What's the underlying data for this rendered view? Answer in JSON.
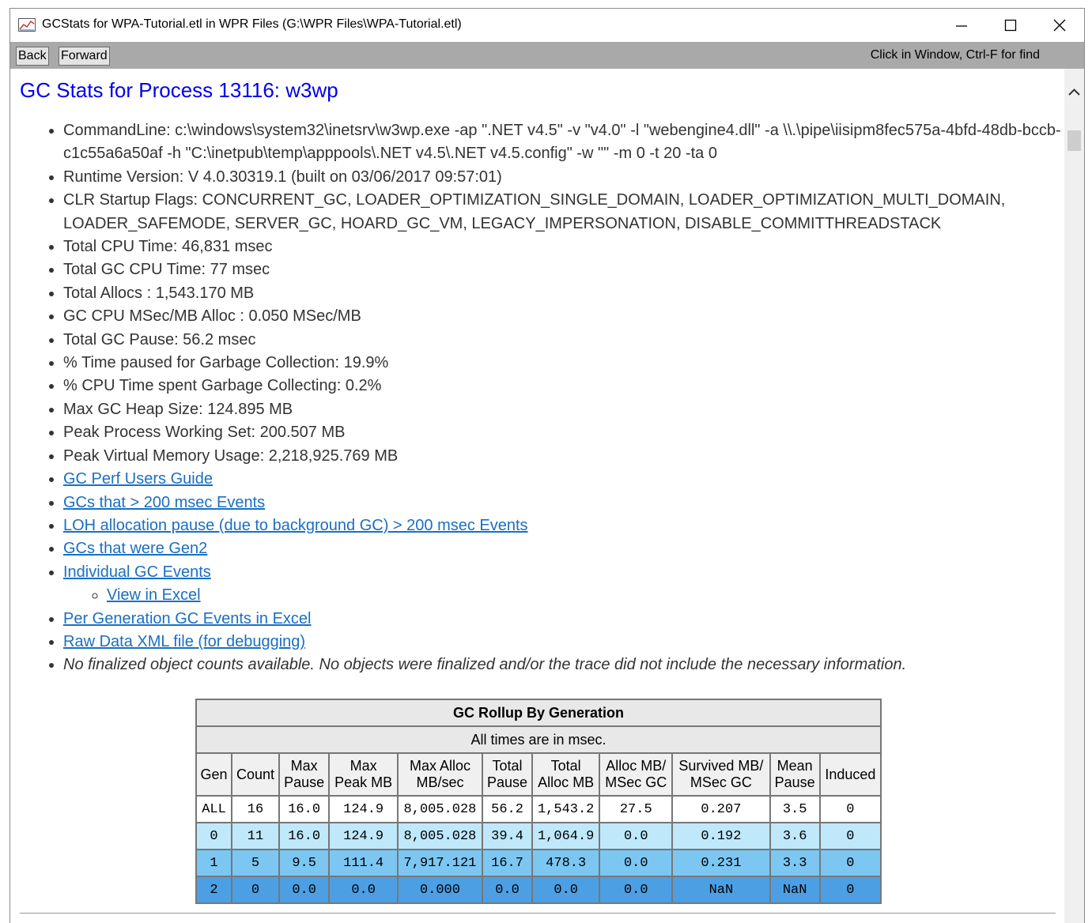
{
  "window": {
    "title": "GCStats for WPA-Tutorial.etl in WPR Files (G:\\WPR Files\\WPA-Tutorial.etl)",
    "minimize_glyph": "—",
    "maximize_glyph": "☐",
    "close_glyph": "✕"
  },
  "toolbar": {
    "back_label": "Back",
    "forward_label": "Forward",
    "hint": "Click in Window, Ctrl-F for find"
  },
  "page": {
    "title": "GC Stats for Process 13116: w3wp",
    "stats": [
      "CommandLine: c:\\windows\\system32\\inetsrv\\w3wp.exe -ap \".NET v4.5\" -v \"v4.0\" -l \"webengine4.dll\" -a \\\\.\\pipe\\iisipm8fec575a-4bfd-48db-bccb-c1c55a6a50af -h \"C:\\inetpub\\temp\\apppools\\.NET v4.5\\.NET v4.5.config\" -w \"\" -m 0 -t 20 -ta 0",
      "Runtime Version: V 4.0.30319.1 (built on 03/06/2017 09:57:01)",
      "CLR Startup Flags: CONCURRENT_GC, LOADER_OPTIMIZATION_SINGLE_DOMAIN, LOADER_OPTIMIZATION_MULTI_DOMAIN, LOADER_SAFEMODE, SERVER_GC, HOARD_GC_VM, LEGACY_IMPERSONATION, DISABLE_COMMITTHREADSTACK",
      "Total CPU Time: 46,831 msec",
      "Total GC CPU Time: 77 msec",
      "Total Allocs : 1,543.170 MB",
      "GC CPU MSec/MB Alloc : 0.050 MSec/MB",
      "Total GC Pause: 56.2 msec",
      "% Time paused for Garbage Collection: 19.9%",
      "% CPU Time spent Garbage Collecting: 0.2%",
      "Max GC Heap Size: 124.895 MB",
      "Peak Process Working Set: 200.507 MB",
      "Peak Virtual Memory Usage: 2,218,925.769 MB"
    ],
    "links": {
      "perf_guide": "GC Perf Users Guide",
      "gcs_200": "GCs that > 200 msec Events",
      "loh_pause": "LOH allocation pause (due to background GC) > 200 msec Events",
      "gen2": "GCs that were Gen2",
      "individual": "Individual GC Events",
      "view_excel": "View in Excel",
      "per_gen_excel": "Per Generation GC Events in Excel",
      "raw_xml": "Raw Data XML file (for debugging)"
    },
    "note": "No finalized object counts available. No objects were finalized and/or the trace did not include the necessary information."
  },
  "rollup": {
    "caption": "GC Rollup By Generation",
    "subcaption": "All times are in msec.",
    "headers": {
      "gen": "Gen",
      "count": "Count",
      "max_pause_1": "Max",
      "max_pause_2": "Pause",
      "max_peak_1": "Max",
      "max_peak_2": "Peak MB",
      "max_alloc_1": "Max Alloc",
      "max_alloc_2": "MB/sec",
      "total_pause_1": "Total",
      "total_pause_2": "Pause",
      "total_alloc_1": "Total",
      "total_alloc_2": "Alloc MB",
      "alloc_ms_1": "Alloc MB/",
      "alloc_ms_2": "MSec GC",
      "survived_1": "Survived MB/",
      "survived_2": "MSec GC",
      "mean_pause_1": "Mean",
      "mean_pause_2": "Pause",
      "induced": "Induced"
    },
    "rows": [
      [
        "ALL",
        "16",
        "16.0",
        "124.9",
        "8,005.028",
        "56.2",
        "1,543.2",
        "27.5",
        "0.207",
        "3.5",
        "0"
      ],
      [
        "0",
        "11",
        "16.0",
        "124.9",
        "8,005.028",
        "39.4",
        "1,064.9",
        "0.0",
        "0.192",
        "3.6",
        "0"
      ],
      [
        "1",
        "5",
        "9.5",
        "111.4",
        "7,917.121",
        "16.7",
        "478.3",
        "0.0",
        "0.231",
        "3.3",
        "0"
      ],
      [
        "2",
        "0",
        "0.0",
        "0.0",
        "0.000",
        "0.0",
        "0.0",
        "0.0",
        "NaN",
        "NaN",
        "0"
      ]
    ]
  },
  "colors": {
    "link": "#1a6fc2",
    "title": "#0000ee",
    "gen0": "#bfe8fb",
    "gen1": "#7cc6f2",
    "gen2": "#4d9fe3"
  }
}
